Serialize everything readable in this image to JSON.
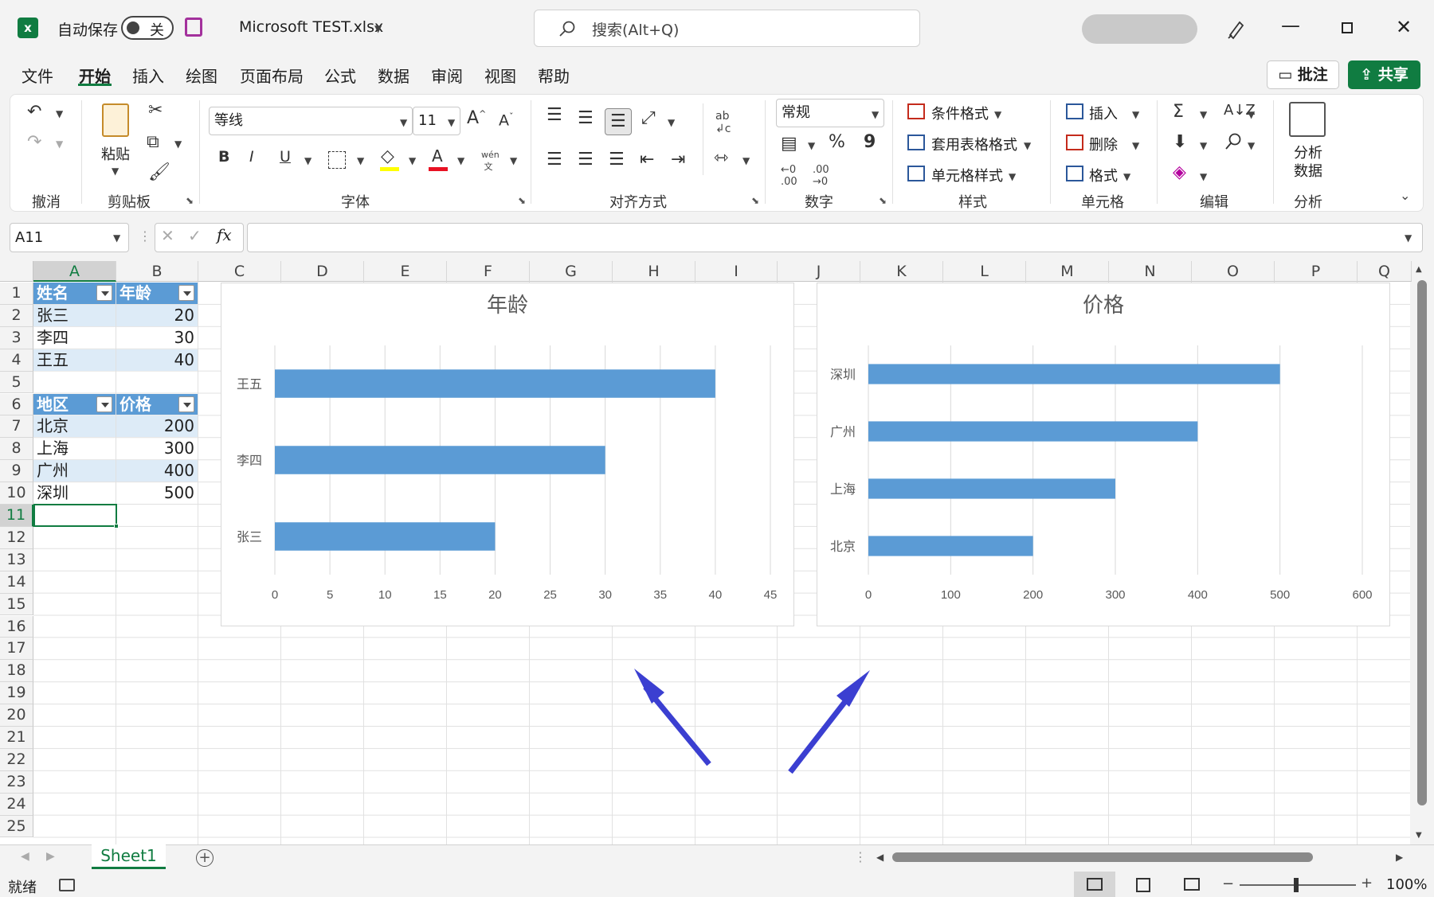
{
  "titlebar": {
    "autosave_label": "自动保存",
    "toggle_state": "关",
    "filename": "Microsoft TEST.xlsx",
    "search_placeholder": "搜索(Alt+Q)"
  },
  "menu": {
    "items": [
      "文件",
      "开始",
      "插入",
      "绘图",
      "页面布局",
      "公式",
      "数据",
      "审阅",
      "视图",
      "帮助"
    ],
    "active": "开始",
    "comment_label": "批注",
    "share_label": "共享"
  },
  "ribbon": {
    "groups": [
      "撤消",
      "剪贴板",
      "字体",
      "对齐方式",
      "数字",
      "样式",
      "单元格",
      "编辑",
      "分析"
    ],
    "paste_label": "粘贴",
    "font_name": "等线",
    "font_size": "11",
    "number_format": "常规",
    "styles": [
      "条件格式",
      "套用表格格式",
      "单元格样式"
    ],
    "cells": [
      "插入",
      "删除",
      "格式"
    ],
    "analyze_label_1": "分析",
    "analyze_label_2": "数据",
    "bold": "B",
    "italic": "I",
    "underline": "U"
  },
  "formula_bar": {
    "name_box": "A11",
    "formula": ""
  },
  "grid": {
    "columns": [
      "A",
      "B",
      "C",
      "D",
      "E",
      "F",
      "G",
      "H",
      "I",
      "J",
      "K",
      "L",
      "M",
      "N",
      "O",
      "P",
      "Q"
    ],
    "rows": [
      "1",
      "2",
      "3",
      "4",
      "5",
      "6",
      "7",
      "8",
      "9",
      "10",
      "11",
      "12",
      "13",
      "14",
      "15",
      "16",
      "17",
      "18",
      "19",
      "20",
      "21",
      "22",
      "23",
      "24",
      "25"
    ],
    "selected_cell": "A11",
    "table1": {
      "headers": [
        "姓名",
        "年龄"
      ],
      "rows": [
        [
          "张三",
          "20"
        ],
        [
          "李四",
          "30"
        ],
        [
          "王五",
          "40"
        ]
      ]
    },
    "table2": {
      "headers": [
        "地区",
        "价格"
      ],
      "rows": [
        [
          "北京",
          "200"
        ],
        [
          "上海",
          "300"
        ],
        [
          "广州",
          "400"
        ],
        [
          "深圳",
          "500"
        ]
      ]
    }
  },
  "chart_data": [
    {
      "type": "bar",
      "orientation": "horizontal",
      "title": "年龄",
      "categories": [
        "张三",
        "李四",
        "王五"
      ],
      "values": [
        20,
        30,
        40
      ],
      "xlim": [
        0,
        45
      ],
      "ticks": [
        0,
        5,
        10,
        15,
        20,
        25,
        30,
        35,
        40,
        45
      ],
      "grid": true,
      "color": "#5b9bd5"
    },
    {
      "type": "bar",
      "orientation": "horizontal",
      "title": "价格",
      "categories": [
        "北京",
        "上海",
        "广州",
        "深圳"
      ],
      "values": [
        200,
        300,
        400,
        500
      ],
      "xlim": [
        0,
        600
      ],
      "ticks": [
        0,
        100,
        200,
        300,
        400,
        500,
        600
      ],
      "grid": true,
      "color": "#5b9bd5"
    }
  ],
  "annotations": {
    "arrow_color": "#3b3fd1",
    "arrow_count": 2
  },
  "sheets": {
    "tabs": [
      "Sheet1"
    ],
    "active": "Sheet1"
  },
  "statusbar": {
    "status": "就绪",
    "zoom": "100%"
  }
}
